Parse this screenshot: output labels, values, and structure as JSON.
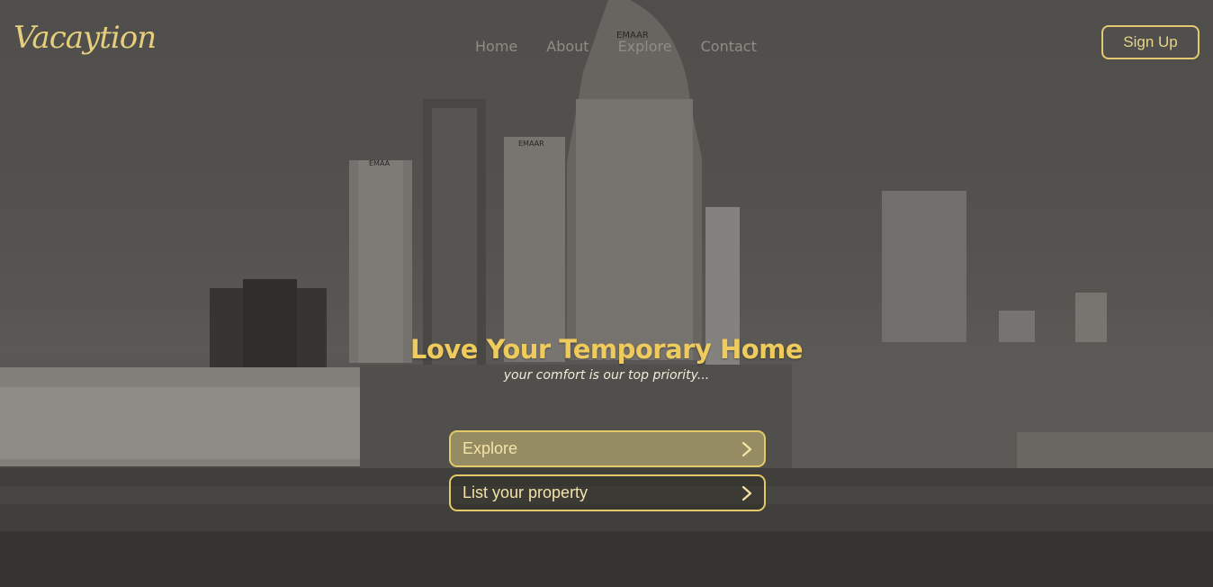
{
  "brand": {
    "logo": "Vacaytion"
  },
  "nav": {
    "items": [
      "Home",
      "About",
      "Explore",
      "Contact"
    ]
  },
  "header": {
    "signup_label": "Sign Up"
  },
  "hero": {
    "title": "Love Your Temporary Home",
    "subtitle": "your comfort is our top priority...",
    "explore_label": "Explore",
    "list_label": "List your property"
  },
  "background": {
    "signage": [
      "EMAAR",
      "EMAAR",
      "EMAA"
    ]
  },
  "colors": {
    "accent": "#e3c967",
    "title": "#eecb5c",
    "nav": "#8e8c86"
  },
  "icons": [
    "chevron-right-icon"
  ]
}
